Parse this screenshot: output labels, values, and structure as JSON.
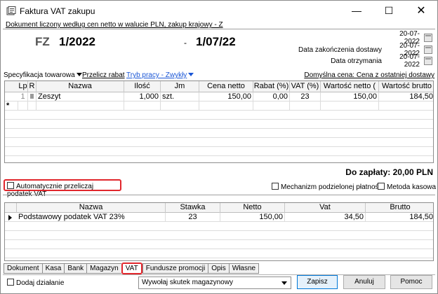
{
  "window": {
    "title": "Faktura VAT zakupu",
    "min_glyph": "—",
    "max_glyph": "☐",
    "close_glyph": "✕"
  },
  "header": {
    "description_link": "Dokument liczony według cen netto w walucie PLN, zakup krajowy - Z",
    "doc_type": "FZ",
    "doc_number": "1/2022",
    "dash": "-",
    "doc_month": "1/07/22",
    "dates": [
      {
        "label": "",
        "value": "20-07-2022"
      },
      {
        "label": "Data zakończenia dostawy",
        "value": "20-07-2022"
      },
      {
        "label": "Data otrzymania",
        "value": "20-07-2022"
      }
    ]
  },
  "spec_bar": {
    "spec": "Specyfikacja towarowa",
    "recalc_discount": "Przelicz rabat",
    "work_mode": "Tryb pracy - Zwykły",
    "default_price": "Domyślna cena: Cena z ostatniej dostawy"
  },
  "items_table": {
    "columns": [
      "Lp",
      "R",
      "Nazwa",
      "Ilość",
      "Jm",
      "Cena netto",
      "Rabat (%)",
      "VAT (%)",
      "Wartość netto (",
      "Wartość brutto"
    ],
    "rows": [
      {
        "lp": "1",
        "r": "",
        "nazwa": "Zeszyt",
        "ilosc": "1,000",
        "jm": "szt.",
        "cena_netto": "150,00",
        "rabat": "0,00",
        "vat": "23",
        "wartosc_netto": "150,00",
        "wartosc_brutto": "184,50"
      }
    ],
    "new_row_marker": "*"
  },
  "totals": {
    "to_pay": "Do zapłaty: 20,00 PLN"
  },
  "options": {
    "auto_vat": "Automatycznie przeliczaj podatek VAT",
    "split_payment": "Mechanizm podzielonej płatności",
    "cash_method": "Metoda kasowa"
  },
  "vat_table": {
    "columns": [
      "Nazwa",
      "Stawka",
      "Netto",
      "Vat",
      "Brutto"
    ],
    "rows": [
      {
        "nazwa": "Podstawowy podatek VAT 23%",
        "stawka": "23",
        "netto": "150,00",
        "vat": "34,50",
        "brutto": "184,50"
      }
    ]
  },
  "tabs": [
    "Dokument",
    "Kasa",
    "Bank",
    "Magazyn",
    "VAT",
    "Fundusze promocji",
    "Opis",
    "Własne"
  ],
  "active_tab": "VAT",
  "footer": {
    "add_action": "Dodaj działanie",
    "warehouse_select": "Wywołaj skutek magazynowy",
    "save": "Zapisz",
    "cancel": "Anuluj",
    "help": "Pomoc"
  },
  "colors": {
    "highlight": "#e1262c",
    "link_blue": "#1a56d6"
  }
}
